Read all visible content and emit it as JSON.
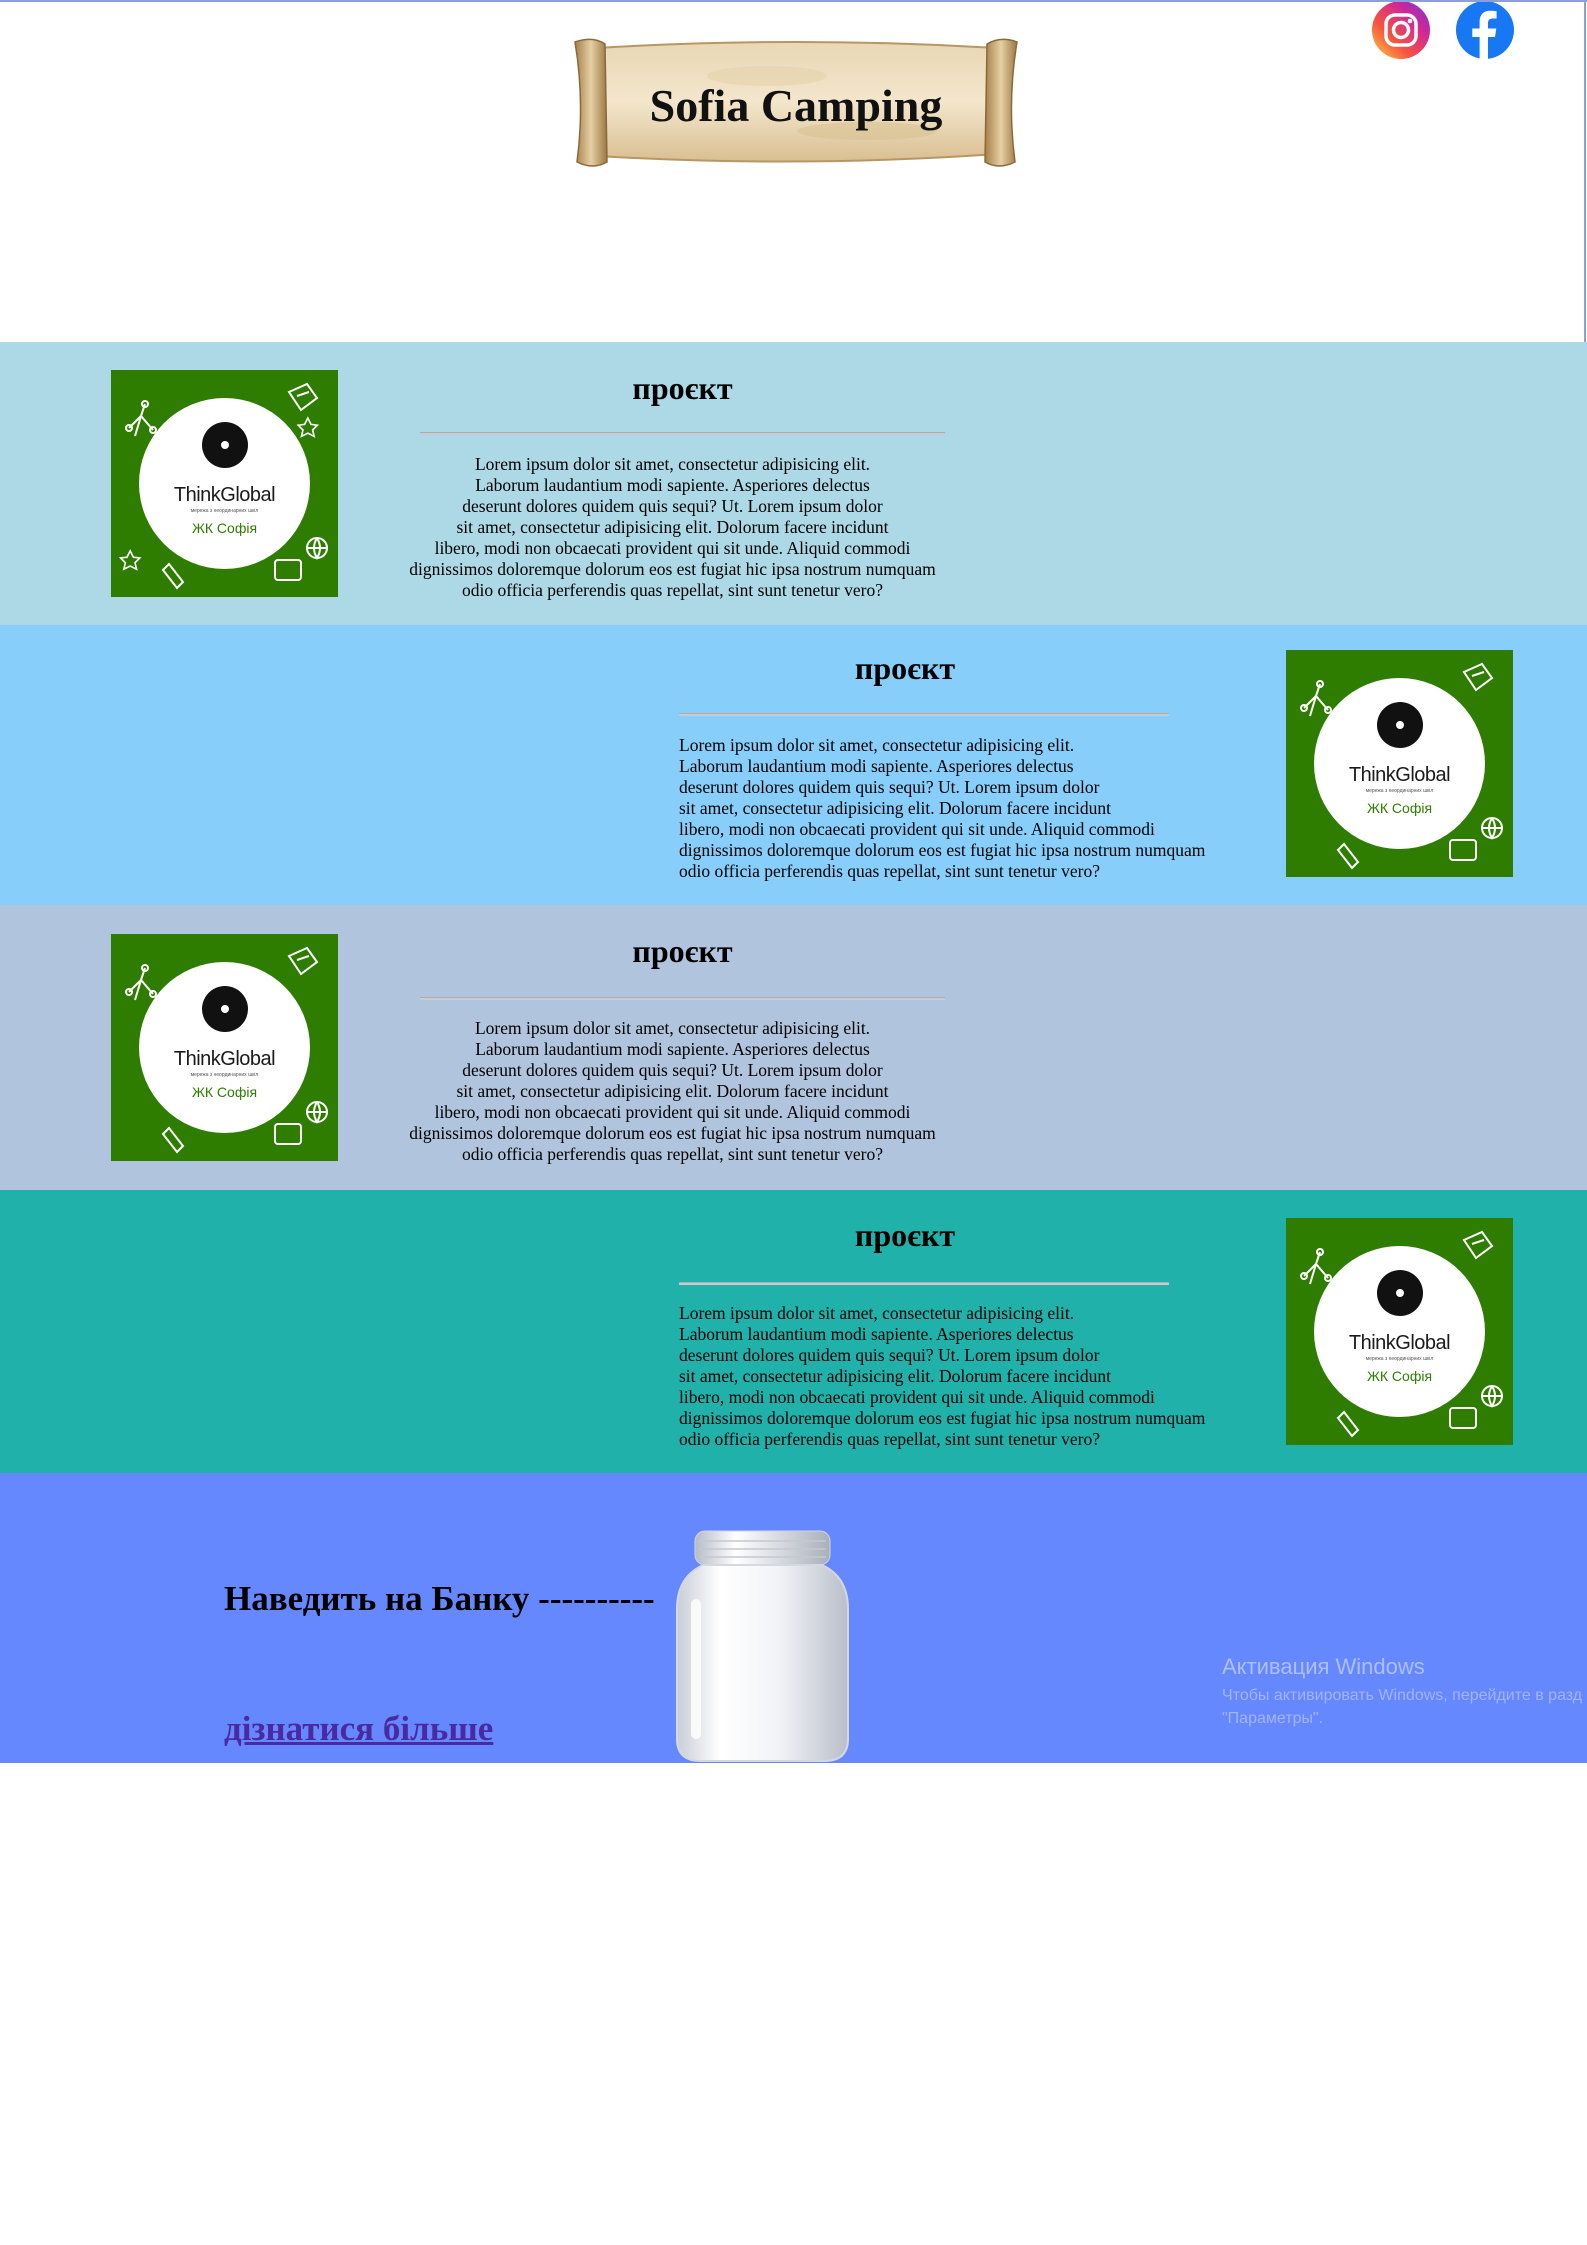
{
  "header": {
    "title": "Sofia Camping",
    "social": [
      {
        "name": "Instagram",
        "icon": "instagram-icon"
      },
      {
        "name": "Facebook",
        "icon": "facebook-icon"
      }
    ]
  },
  "logo": {
    "brand": "ThinkGlobal",
    "subtitle": "мережа з неординарних шкіл",
    "place": "ЖК Софія",
    "background": "#2e7d00"
  },
  "projects": [
    {
      "title": "проєкт",
      "background": "#add8e6",
      "lines": [
        "Lorem ipsum dolor sit amet, consectetur adipisicing elit.",
        "Laborum laudantium modi sapiente. Asperiores delectus",
        "deserunt dolores quidem quis sequi? Ut. Lorem ipsum dolor",
        "sit amet, consectetur adipisicing elit. Dolorum facere incidunt",
        "libero, modi non obcaecati provident qui sit unde. Aliquid commodi",
        "dignissimos doloremque dolorum eos est fugiat hic ipsa nostrum numquam",
        "odio officia perferendis quas repellat, sint sunt tenetur vero?"
      ]
    },
    {
      "title": "проєкт",
      "background": "#87cefa",
      "lines": [
        "Lorem ipsum dolor sit amet, consectetur adipisicing elit.",
        "Laborum laudantium modi sapiente. Asperiores delectus",
        "deserunt dolores quidem quis sequi? Ut. Lorem ipsum dolor",
        "sit amet, consectetur adipisicing elit. Dolorum facere incidunt",
        "libero, modi non obcaecati provident qui sit unde. Aliquid commodi",
        "dignissimos doloremque dolorum eos est fugiat hic ipsa nostrum numquam",
        "odio officia perferendis quas repellat, sint sunt tenetur vero?"
      ]
    },
    {
      "title": "проєкт",
      "background": "#b0c4de",
      "lines": [
        "Lorem ipsum dolor sit amet, consectetur adipisicing elit.",
        "Laborum laudantium modi sapiente. Asperiores delectus",
        "deserunt dolores quidem quis sequi? Ut. Lorem ipsum dolor",
        "sit amet, consectetur adipisicing elit. Dolorum facere incidunt",
        "libero, modi non obcaecati provident qui sit unde. Aliquid commodi",
        "dignissimos doloremque dolorum eos est fugiat hic ipsa nostrum numquam",
        "odio officia perferendis quas repellat, sint sunt tenetur vero?"
      ]
    },
    {
      "title": "проєкт",
      "background": "#20b2aa",
      "lines": [
        "Lorem ipsum dolor sit amet, consectetur adipisicing elit.",
        "Laborum laudantium modi sapiente. Asperiores delectus",
        "deserunt dolores quidem quis sequi? Ut. Lorem ipsum dolor",
        "sit amet, consectetur adipisicing elit. Dolorum facere incidunt",
        "libero, modi non obcaecati provident qui sit unde. Aliquid commodi",
        "dignissimos doloremque dolorum eos est fugiat hic ipsa nostrum numquam",
        "odio officia perferendis quas repellat, sint sunt tenetur vero?"
      ]
    }
  ],
  "footer": {
    "background": "#6688ff",
    "cta": "Наведить на Банку ----------",
    "link": "дізнатися більше",
    "jar_icon": "jar-icon",
    "watermark_title": "Активация Windows",
    "watermark_sub1": "Чтобы активировать Windows, перейдите в разд",
    "watermark_sub2": "\"Параметры\"."
  }
}
